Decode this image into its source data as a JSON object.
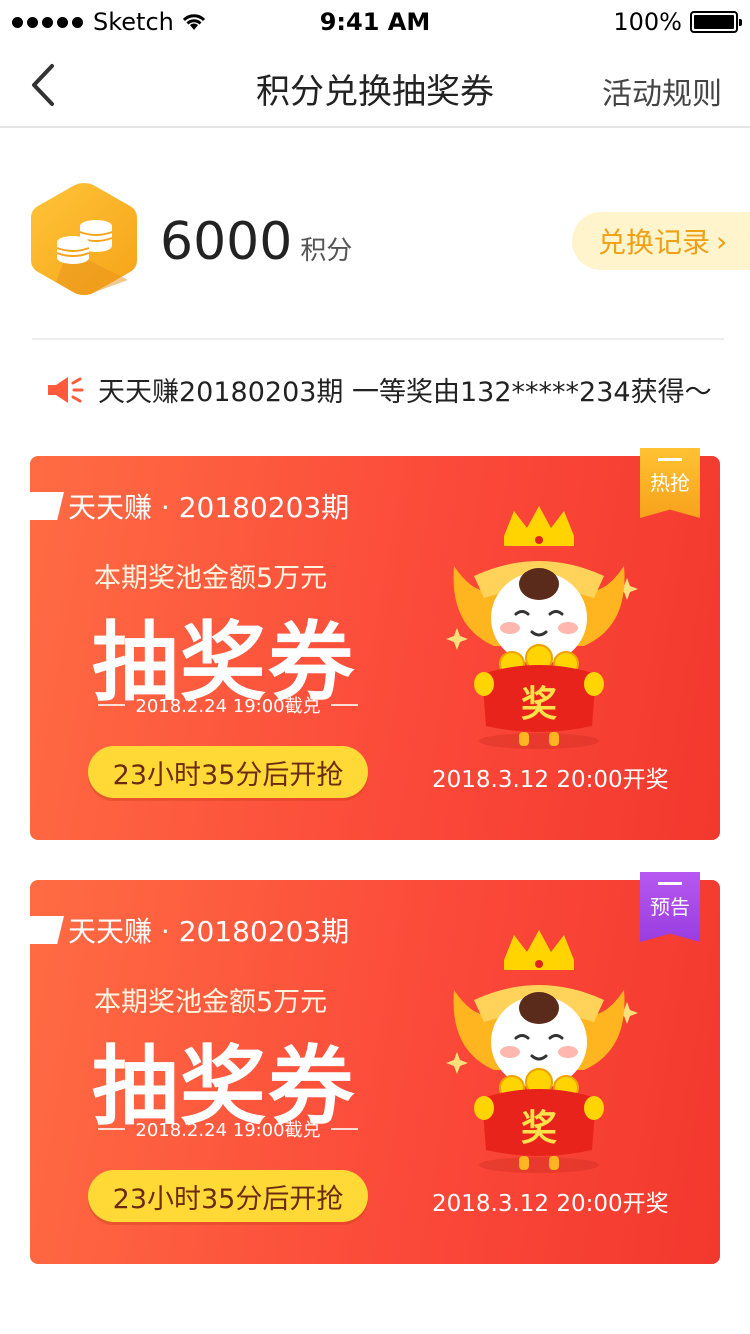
{
  "status_bar": {
    "carrier": "Sketch",
    "time": "9:41 AM",
    "battery_percent": "100%"
  },
  "nav": {
    "title": "积分兑换抽奖券",
    "right_link": "活动规则"
  },
  "points": {
    "value": "6000",
    "unit": "积分",
    "history_button": "兑换记录"
  },
  "notice": {
    "text": "天天赚20180203期 一等奖由132*****234获得～"
  },
  "tickets": [
    {
      "badge": "热抢",
      "badge_color": "#f7a21b",
      "issue": "天天赚 · 20180203期",
      "pool": "本期奖池金额5万元",
      "title": "抽奖券",
      "deadline": "2018.2.24 19:00截兑",
      "countdown": "23小时35分后开抢",
      "draw_time": "2018.3.12 20:00开奖",
      "mascot_label": "奖"
    },
    {
      "badge": "预告",
      "badge_color": "#9a3de0",
      "issue": "天天赚 · 20180203期",
      "pool": "本期奖池金额5万元",
      "title": "抽奖券",
      "deadline": "2018.2.24 19:00截兑",
      "countdown": "23小时35分后开抢",
      "draw_time": "2018.3.12 20:00开奖",
      "mascot_label": "奖"
    }
  ],
  "colors": {
    "accent_orange": "#f0a016",
    "ticket_red": "#f3382e",
    "button_yellow": "#ffd935"
  }
}
